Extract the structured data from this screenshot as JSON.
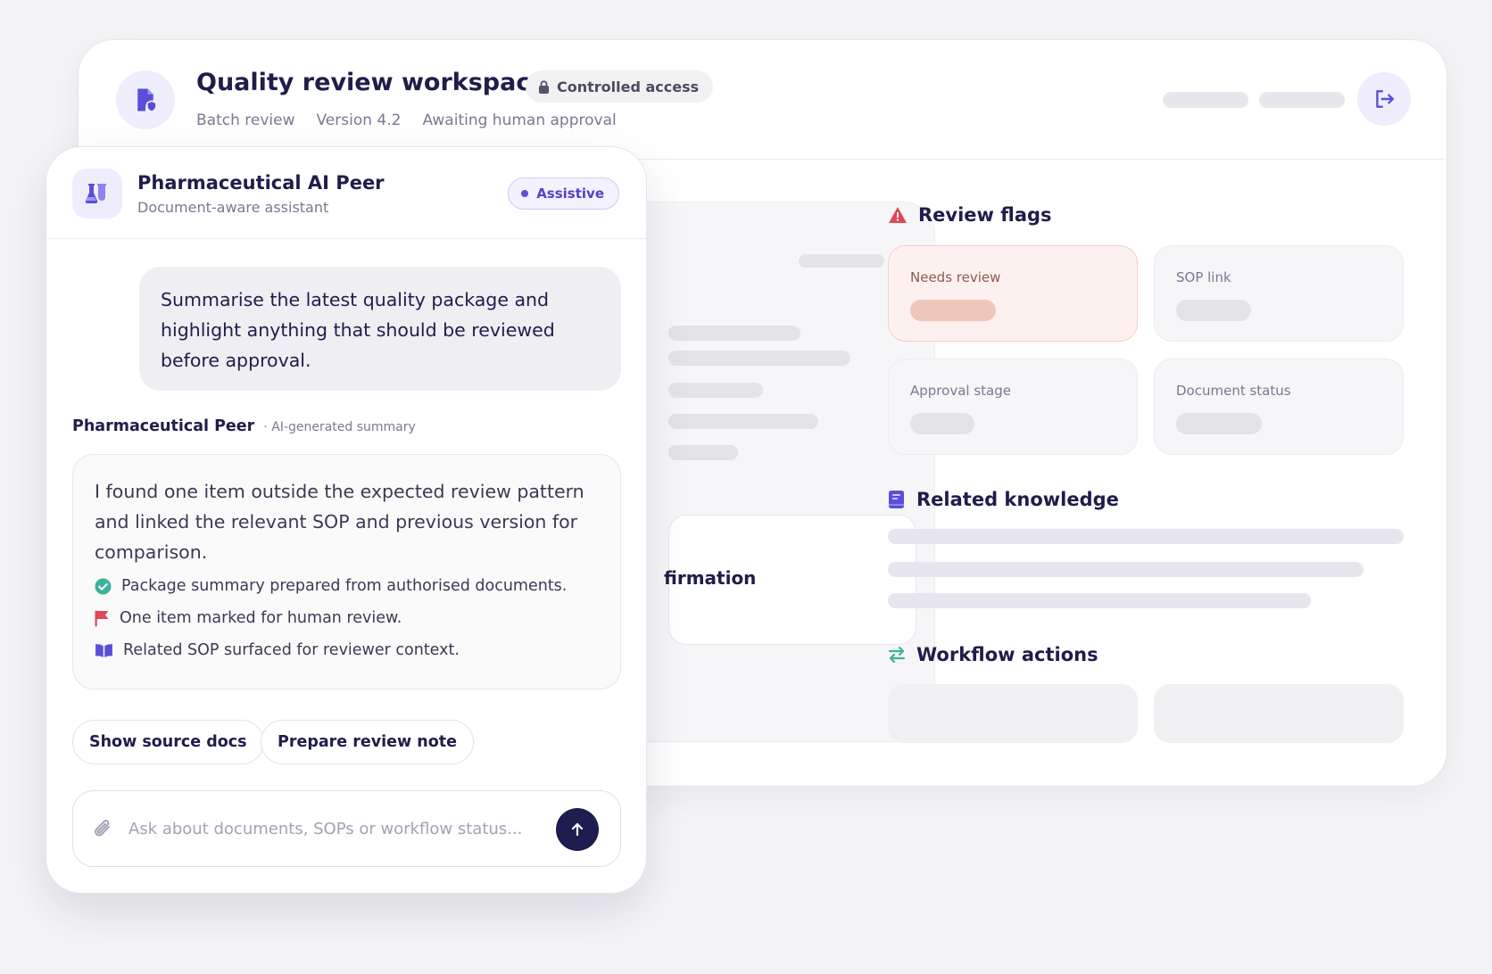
{
  "workspace": {
    "title": "Quality review workspace",
    "access_label": "Controlled access",
    "meta": [
      "Batch review",
      "Version 4.2",
      "Awaiting human approval"
    ],
    "icons": {
      "logo": "document-shield-icon",
      "access": "lock-icon",
      "exit": "exit-icon"
    },
    "partial_document_text": "firmation"
  },
  "review_flags": {
    "title": "Review flags",
    "icon": "warning-triangle-icon",
    "cards": [
      {
        "label": "Needs review",
        "status": "alert"
      },
      {
        "label": "SOP link",
        "status": "neutral"
      },
      {
        "label": "Approval stage",
        "status": "neutral"
      },
      {
        "label": "Document status",
        "status": "neutral"
      }
    ]
  },
  "related_knowledge": {
    "title": "Related knowledge",
    "icon": "book-icon"
  },
  "workflow_actions": {
    "title": "Workflow actions",
    "icon": "swap-arrows-icon"
  },
  "chat": {
    "name": "Pharmaceutical AI Peer",
    "subtitle": "Document-aware assistant",
    "mode_badge": "Assistive",
    "icon": "flask-icon",
    "user_message": "Summarise the latest quality package and highlight anything that should be reviewed before approval.",
    "reply": {
      "author": "Pharmaceutical Peer",
      "tag": "· AI-generated summary",
      "text": "I found one item outside the expected review pattern and linked the relevant SOP and previous version for comparison.",
      "bullets": [
        {
          "icon": "check-circle-icon",
          "text": "Package summary prepared from authorised documents."
        },
        {
          "icon": "flag-icon",
          "text": "One item marked for human review."
        },
        {
          "icon": "open-book-icon",
          "text": "Related SOP surfaced for reviewer context."
        }
      ]
    },
    "suggestions": [
      "Show source docs",
      "Prepare review note"
    ],
    "composer": {
      "placeholder": "Ask about documents, SOPs or workflow status...",
      "value": ""
    }
  },
  "colors": {
    "accent": "#5b4fd9",
    "navy": "#1f1c4f",
    "alert": "#e0475b",
    "success": "#3bb39a"
  }
}
